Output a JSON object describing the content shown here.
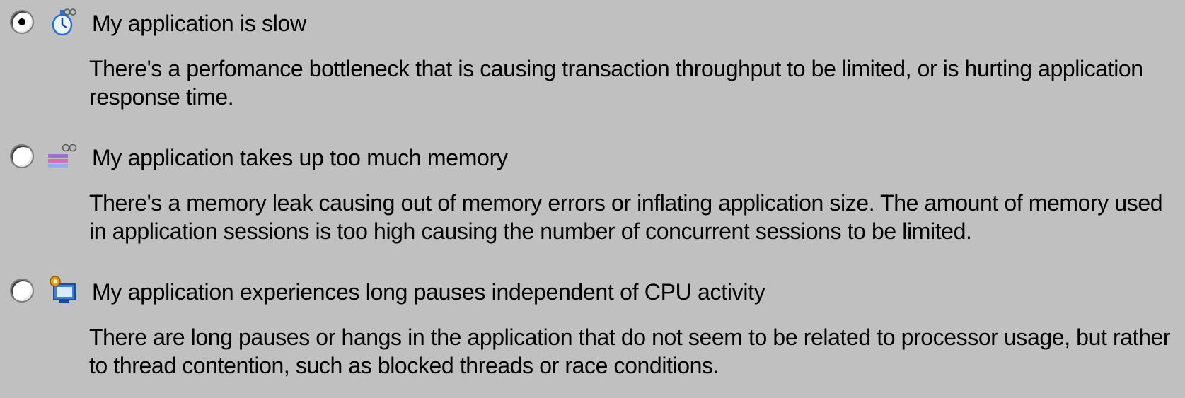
{
  "options": [
    {
      "title": "My application is slow",
      "description": "There's a perfomance bottleneck that is causing transaction throughput to be limited, or is hurting application response time.",
      "selected": true,
      "icon": "stopwatch-icon"
    },
    {
      "title": "My application takes up too much memory",
      "description": "There's a memory leak causing out of memory errors or inflating application size. The amount of memory used in application sessions is too high causing the number of concurrent sessions to be limited.",
      "selected": false,
      "icon": "memory-stack-icon"
    },
    {
      "title": "My application experiences long pauses independent of CPU activity",
      "description": "There are long pauses or hangs in the application that do not seem to be related to processor usage, but rather to thread contention, such as blocked threads or race conditions.",
      "selected": false,
      "icon": "gear-monitor-icon"
    }
  ],
  "colors": {
    "background": "#c0c0c0",
    "text": "#000000"
  }
}
